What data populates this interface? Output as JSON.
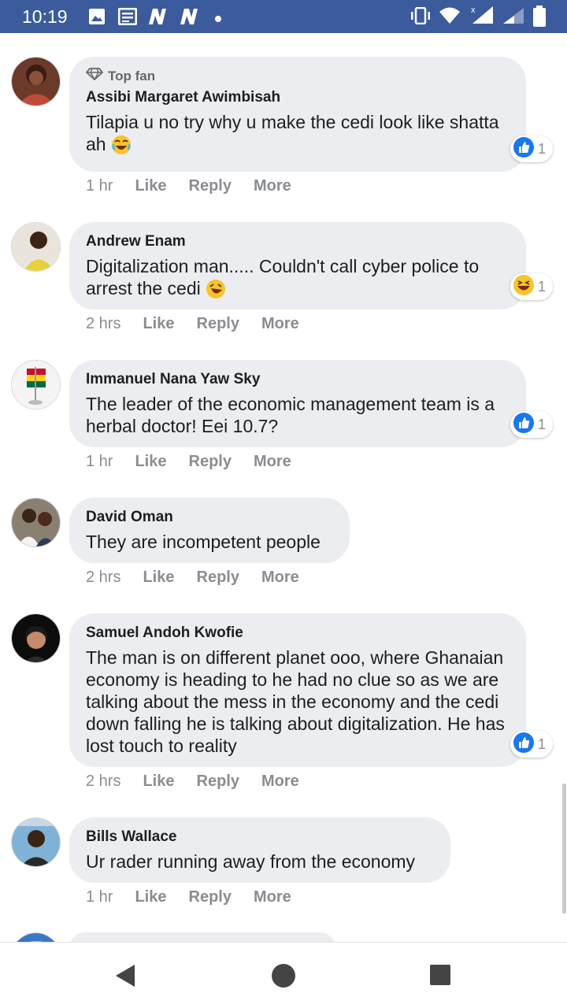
{
  "status_bar": {
    "time": "10:19",
    "icons": [
      "image-icon",
      "news-icon",
      "n-app-icon",
      "n-app-icon",
      "dot-icon",
      "vibrate-icon",
      "wifi-icon",
      "signal-icon",
      "signal-icon",
      "battery-icon"
    ]
  },
  "comments": [
    {
      "badge": "Top fan",
      "author": "Assibi Margaret Awimbisah",
      "text": "Tilapia u no try why u make the cedi look like shatta ah",
      "emoji": "joy-emoji",
      "time": "1 hr",
      "reaction": {
        "type": "like",
        "count": "1"
      }
    },
    {
      "author": "Andrew Enam",
      "text": "Digitalization man..... Couldn't call cyber police to arrest the cedi",
      "emoji": "rofl-emoji",
      "time": "2 hrs",
      "reaction": {
        "type": "haha",
        "count": "1"
      }
    },
    {
      "author": "Immanuel Nana Yaw Sky",
      "text": "The leader of the economic management team is a herbal doctor! Eei 10.7?",
      "time": "1 hr",
      "reaction": {
        "type": "like",
        "count": "1"
      }
    },
    {
      "author": "David Oman",
      "text": "They are incompetent people",
      "time": "2 hrs"
    },
    {
      "author": "Samuel Andoh Kwofie",
      "text": "The man is on different planet ooo, where Ghanaian economy is heading to he had no clue so as we are talking about the mess in the economy and the cedi down falling he is talking about digitalization. He has lost touch to reality",
      "time": "2 hrs",
      "reaction": {
        "type": "like",
        "count": "1"
      }
    },
    {
      "author": "Bills Wallace",
      "text": "Ur rader running away from the economy",
      "time": "1 hr"
    }
  ],
  "action_labels": {
    "like": "Like",
    "reply": "Reply",
    "more": "More"
  },
  "colors": {
    "status_bar": "#3b5b9c",
    "bubble": "#ebedf0",
    "like_blue": "#1877f2",
    "muted": "#8a8d91"
  },
  "nav_bar": {
    "icons": [
      "back-icon",
      "home-icon",
      "recents-icon"
    ]
  }
}
